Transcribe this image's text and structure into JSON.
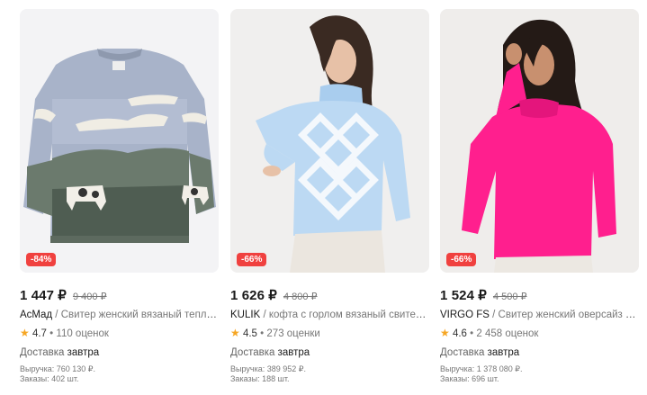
{
  "products": [
    {
      "discount": "-84%",
      "price": "1 447 ₽",
      "old_price": "9 400 ₽",
      "brand": "AcMaд",
      "sep": " / ",
      "name": "Свитер женский вязаный теплый оверсайз",
      "rating": "4.7",
      "reviews": "110 оценок",
      "delivery_label": "Доставка",
      "delivery_day": "завтра",
      "revenue": "Выручка: 760 130 ₽.",
      "orders": "Заказы: 402 шт.",
      "image_icon": "sweater-cow-icon"
    },
    {
      "discount": "-66%",
      "price": "1 626 ₽",
      "old_price": "4 800 ₽",
      "brand": "KULIK",
      "sep": " / ",
      "name": "кофта с горлом вязаный свитер голубой",
      "rating": "4.5",
      "reviews": "273 оценки",
      "delivery_label": "Доставка",
      "delivery_day": "завтра",
      "revenue": "Выручка: 389 952 ₽.",
      "orders": "Заказы: 188 шт.",
      "image_icon": "turtleneck-model-icon"
    },
    {
      "discount": "-66%",
      "price": "1 524 ₽",
      "old_price": "4 500 ₽",
      "brand": "VIRGO FS",
      "sep": " / ",
      "name": "Свитер женский оверсайз зимний",
      "rating": "4.6",
      "reviews": "2 458 оценок",
      "delivery_label": "Доставка",
      "delivery_day": "завтра",
      "revenue": "Выручка: 1 378 080 ₽.",
      "orders": "Заказы: 696 шт.",
      "image_icon": "pink-sweater-model-icon"
    }
  ],
  "colors": {
    "discount_badge": "#f0413f",
    "star": "#f6a623",
    "pink_sweater": "#ff1f8e",
    "blue_sweater": "#bcd9f3"
  }
}
